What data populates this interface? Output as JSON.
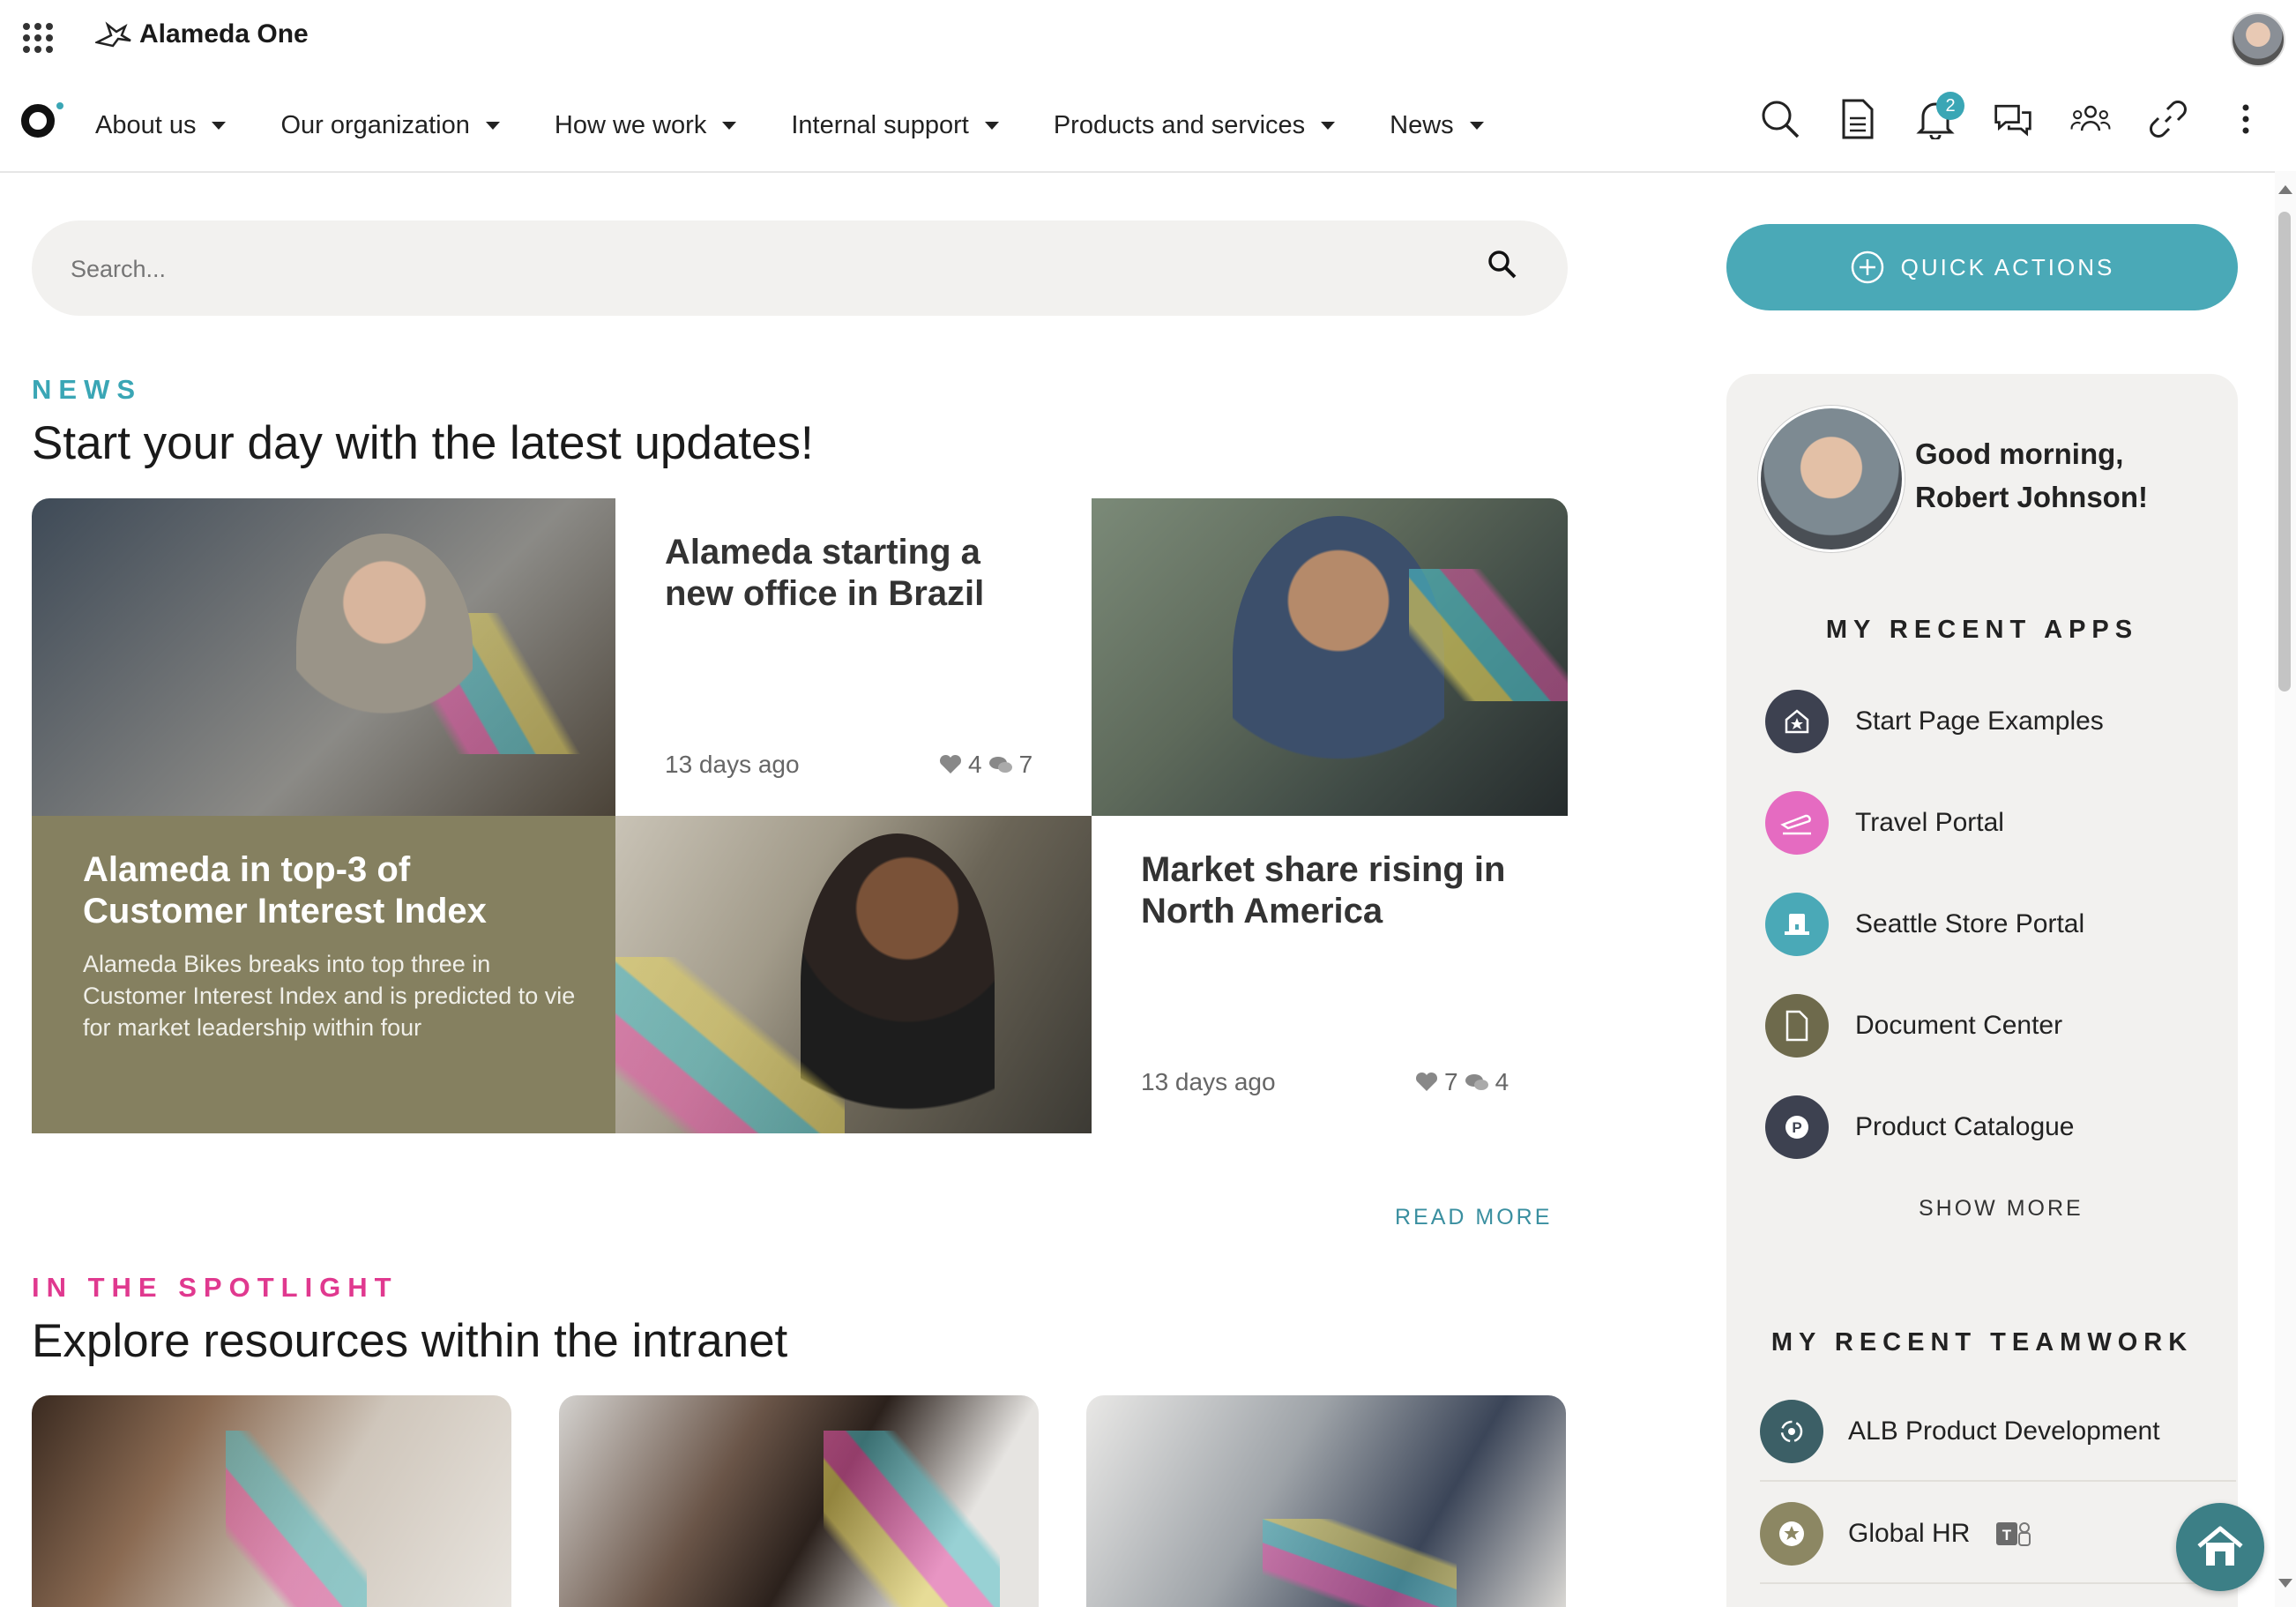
{
  "app": {
    "brand": "Alameda One"
  },
  "nav": {
    "items": [
      "About us",
      "Our organization",
      "How we work",
      "Internal support",
      "Products and services",
      "News"
    ],
    "notification_count": "2"
  },
  "search": {
    "placeholder": "Search..."
  },
  "quick_actions": {
    "label": "QUICK ACTIONS"
  },
  "news": {
    "kicker": "NEWS",
    "heading": "Start your day with the latest updates!",
    "articles": [
      {
        "title": "Alameda starting a new office in Brazil",
        "date": "13 days ago",
        "likes": "4",
        "comments": "7"
      },
      {
        "title": "Alameda in top-3 of Customer Interest Index",
        "summary": "Alameda Bikes breaks into top three in Customer Interest Index and is predicted to vie for market leadership within four"
      },
      {
        "title": "Market share rising in North America",
        "date": "13 days ago",
        "likes": "7",
        "comments": "4"
      }
    ],
    "read_more": "READ MORE"
  },
  "spotlight": {
    "kicker": "IN THE SPOTLIGHT",
    "heading": "Explore resources within the intranet"
  },
  "sidebar": {
    "greeting_line1": "Good morning,",
    "greeting_line2": "Robert Johnson!",
    "recent_apps_title": "MY RECENT APPS",
    "apps": [
      {
        "label": "Start Page Examples",
        "color": "#3d4150"
      },
      {
        "label": "Travel Portal",
        "color": "#e56bc1"
      },
      {
        "label": "Seattle Store Portal",
        "color": "#4aa9b7"
      },
      {
        "label": "Document Center",
        "color": "#6e6a4c"
      },
      {
        "label": "Product Catalogue",
        "color": "#3d4150"
      }
    ],
    "show_more": "SHOW MORE",
    "recent_teamwork_title": "MY RECENT TEAMWORK",
    "teamwork": [
      {
        "label": "ALB Product Development",
        "color": "#3c5f66"
      },
      {
        "label": "Global HR",
        "color": "#8c8763"
      }
    ]
  },
  "colors": {
    "accent": "#4aa9b7",
    "spotlight": "#e0398f",
    "news_kicker": "#3aa6b5",
    "olive": "#858060"
  }
}
